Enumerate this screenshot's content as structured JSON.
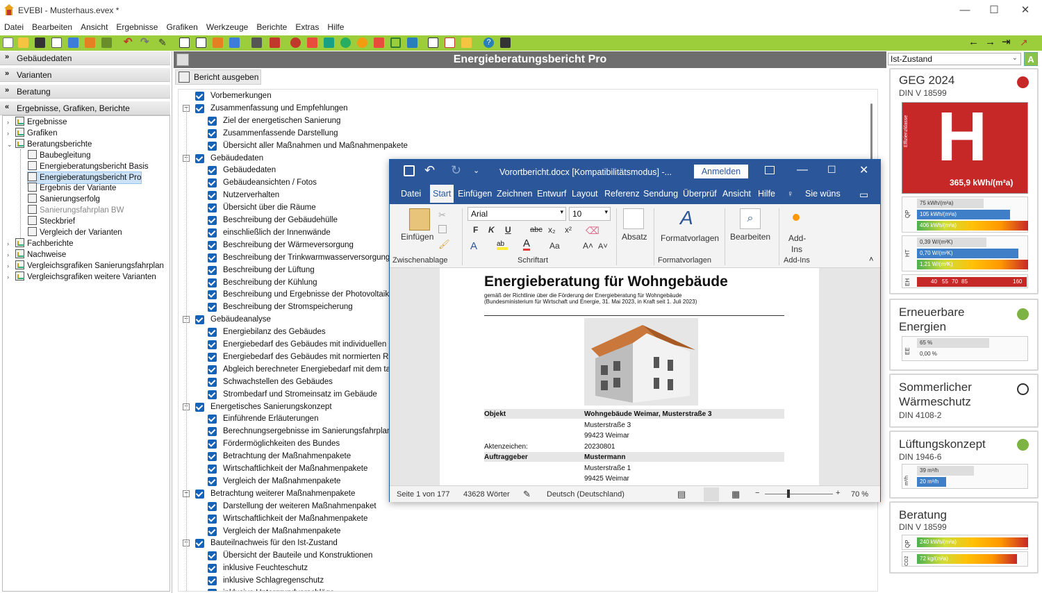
{
  "window": {
    "title": "EVEBI - Musterhaus.evex *",
    "minimize": "—",
    "maximize": "☐",
    "close": "✕"
  },
  "menu": [
    "Datei",
    "Bearbeiten",
    "Ansicht",
    "Ergebnisse",
    "Grafiken",
    "Werkzeuge",
    "Berichte",
    "Extras",
    "Hilfe"
  ],
  "toolbar": {
    "accent": "#9ccd3b"
  },
  "left": {
    "sections": [
      "Gebäudedaten",
      "Varianten",
      "Beratung",
      "Ergebnisse, Grafiken, Berichte"
    ],
    "tree": [
      {
        "label": "Ergebnisse",
        "level": 0,
        "tw": "›"
      },
      {
        "label": "Grafiken",
        "level": 0,
        "tw": "›"
      },
      {
        "label": "Beratungsberichte",
        "level": 0,
        "tw": "⌄"
      },
      {
        "label": "Baubegleitung",
        "level": 1
      },
      {
        "label": "Energieberatungsbericht Basis",
        "level": 1
      },
      {
        "label": "Energieberatungsbericht Pro",
        "level": 1,
        "selected": true
      },
      {
        "label": "Ergebnis der Variante",
        "level": 1
      },
      {
        "label": "Sanierungserfolg",
        "level": 1
      },
      {
        "label": "Sanierungsfahrplan BW",
        "level": 1,
        "disabled": true
      },
      {
        "label": "Steckbrief",
        "level": 1
      },
      {
        "label": "Vergleich der Varianten",
        "level": 1
      },
      {
        "label": "Fachberichte",
        "level": 0,
        "tw": "›"
      },
      {
        "label": "Nachweise",
        "level": 0,
        "tw": "›"
      },
      {
        "label": "Vergleichsgrafiken Sanierungsfahrplan",
        "level": 0,
        "tw": "›"
      },
      {
        "label": "Vergleichsgrafiken weitere Varianten",
        "level": 0,
        "tw": "›"
      }
    ]
  },
  "header": {
    "title": "Energieberatungsbericht Pro",
    "print_button": "Bericht ausgeben"
  },
  "checklist": [
    {
      "label": "Vorbemerkungen",
      "level": 0
    },
    {
      "label": "Zusammenfassung und Empfehlungen",
      "level": 0,
      "exp": "−"
    },
    {
      "label": "Ziel der energetischen Sanierung",
      "level": 1
    },
    {
      "label": "Zusammenfassende Darstellung",
      "level": 1
    },
    {
      "label": "Übersicht aller Maßnahmen und Maßnahmenpakete",
      "level": 1
    },
    {
      "label": "Gebäudedaten",
      "level": 0,
      "exp": "−"
    },
    {
      "label": "Gebäudedaten",
      "level": 1
    },
    {
      "label": "Gebäudeansichten / Fotos",
      "level": 1
    },
    {
      "label": "Nutzerverhalten",
      "level": 1
    },
    {
      "label": "Übersicht über die Räume",
      "level": 1
    },
    {
      "label": "Beschreibung der Gebäudehülle",
      "level": 1
    },
    {
      "label": "einschließlich der Innenwände",
      "level": 1
    },
    {
      "label": "Beschreibung der Wärmeversorgung",
      "level": 1
    },
    {
      "label": "Beschreibung der Trinkwarmwasserversorgung",
      "level": 1
    },
    {
      "label": "Beschreibung der Lüftung",
      "level": 1
    },
    {
      "label": "Beschreibung der Kühlung",
      "level": 1
    },
    {
      "label": "Beschreibung und Ergebnisse der Photovoltaik-Anl",
      "level": 1
    },
    {
      "label": "Beschreibung der Stromspeicherung",
      "level": 1
    },
    {
      "label": "Gebäudeanalyse",
      "level": 0,
      "exp": "−"
    },
    {
      "label": "Energiebilanz des Gebäudes",
      "level": 1
    },
    {
      "label": "Energiebedarf des Gebäudes mit individuellen Ran",
      "level": 1
    },
    {
      "label": "Energiebedarf des Gebäudes mit normierten Randl",
      "level": 1
    },
    {
      "label": "Abgleich berechneter Energiebedarf mit dem tatsä",
      "level": 1
    },
    {
      "label": "Schwachstellen des Gebäudes",
      "level": 1
    },
    {
      "label": "Strombedarf und Stromeinsatz im Gebäude",
      "level": 1
    },
    {
      "label": "Energetisches Sanierungskonzept",
      "level": 0,
      "exp": "−"
    },
    {
      "label": "Einführende Erläuterungen",
      "level": 1
    },
    {
      "label": "Berechnungsergebnisse im Sanierungsfahrplan",
      "level": 1
    },
    {
      "label": "Fördermöglichkeiten des Bundes",
      "level": 1
    },
    {
      "label": "Betrachtung der Maßnahmenpakete",
      "level": 1
    },
    {
      "label": "Wirtschaftlichkeit der Maßnahmenpakete",
      "level": 1
    },
    {
      "label": "Vergleich der Maßnahmenpakete",
      "level": 1
    },
    {
      "label": "Betrachtung weiterer Maßnahmenpakete",
      "level": 0,
      "exp": "−"
    },
    {
      "label": "Darstellung der weiteren Maßnahmenpaket",
      "level": 1
    },
    {
      "label": "Wirtschaftlichkeit der Maßnahmenpakete",
      "level": 1
    },
    {
      "label": "Vergleich der Maßnahmenpakete",
      "level": 1
    },
    {
      "label": "Bauteilnachweis für den Ist-Zustand",
      "level": 0,
      "exp": "−"
    },
    {
      "label": "Übersicht der Bauteile und Konstruktionen",
      "level": 1
    },
    {
      "label": "inklusive Feuchteschutz",
      "level": 1
    },
    {
      "label": "inklusive Schlagregenschutz",
      "level": 1
    },
    {
      "label": "inklusive Untergrundvorschläge",
      "level": 1
    }
  ],
  "right": {
    "state_select": "Ist-Zustand",
    "a_button": "A",
    "geg": {
      "title": "GEG 2024",
      "subtitle": "DIN V 18599",
      "status": "#c62828",
      "class": "H",
      "class_label": "Effizienzklasse",
      "value": "365,9 kWh/(m²a)",
      "qp_label": "QP",
      "qp": [
        "75 kWh/(m²a)",
        "105 kWh/(m²a)",
        "406 kWh/(m²a)"
      ],
      "ht_label": "HT",
      "ht": [
        "0,39 W/(m²K)",
        "0,70 W/(m²K)",
        "1,21 W/(m²K)"
      ],
      "eh_label": "EH",
      "eh": [
        "40",
        "55",
        "70",
        "85",
        "160"
      ]
    },
    "ee": {
      "title1": "Erneuerbare",
      "title2": "Energien",
      "status": "#7cb342",
      "label": "EE",
      "rows": [
        "65 %",
        "0,00 %"
      ]
    },
    "sws": {
      "title1": "Sommerlicher",
      "title2": "Wärmeschutz",
      "subtitle": "DIN 4108-2"
    },
    "lk": {
      "title": "Lüftungskonzept",
      "subtitle": "DIN 1946-6",
      "status": "#7cb342",
      "label": "m³/h",
      "rows": [
        "39 m³/h",
        "20 m³/h"
      ]
    },
    "ber": {
      "title": "Beratung",
      "subtitle": "DIN V 18599",
      "rows": [
        "240 kWh/(m²a)",
        "72 kg/(m²a)"
      ],
      "labels": [
        "QP",
        "CO2"
      ]
    }
  },
  "word": {
    "title": "Vorortbericht.docx [Kompatibilitätsmodus] -...",
    "signin": "Anmelden",
    "tabs": [
      "Datei",
      "Start",
      "Einfügen",
      "Zeichnen",
      "Entwurf",
      "Layout",
      "Referenz",
      "Sendung",
      "Überprüf",
      "Ansicht",
      "Hilfe",
      "Sie wüns"
    ],
    "ribbon": {
      "paste": "Einfügen",
      "font": "Arial",
      "size": "10",
      "bold": "F",
      "italic": "K",
      "underline": "U",
      "strike": "abc",
      "sub": "x₂",
      "sup": "x²",
      "case": "Aa",
      "grow": "A˄",
      "shrink": "A˅",
      "absatz": "Absatz",
      "formatvorlagen": "Formatvorlagen",
      "bearbeiten": "Bearbeiten",
      "addins1": "Add-",
      "addins2": "Ins",
      "groups": [
        "Zwischenablage",
        "Schriftart",
        "Formatvorlagen",
        "Add-Ins"
      ]
    },
    "doc": {
      "heading": "Energieberatung für Wohngebäude",
      "sub1": "gemäß der Richtlinie über die Förderung der Energieberatung für Wohngebäude",
      "sub2": "(Bundesministerium für Wirtschaft und Energie, 31. Mai 2023, in Kraft seit 1. Juli 2023)",
      "objekt_l": "Objekt",
      "objekt_v": "Wohngebäude Weimar, Musterstraße 3",
      "addr1": "Musterstraße 3",
      "addr2": "99423 Weimar",
      "az_l": "Aktenzeichen:",
      "az_v": "20230801",
      "ag_l": "Auftraggeber",
      "ag_v": "Mustermann",
      "ag1": "Musterstraße 1",
      "ag2": "99425 Weimar"
    },
    "status": {
      "page": "Seite 1 von 177",
      "words": "43628 Wörter",
      "lang": "Deutsch (Deutschland)",
      "zoom": "70 %"
    }
  }
}
